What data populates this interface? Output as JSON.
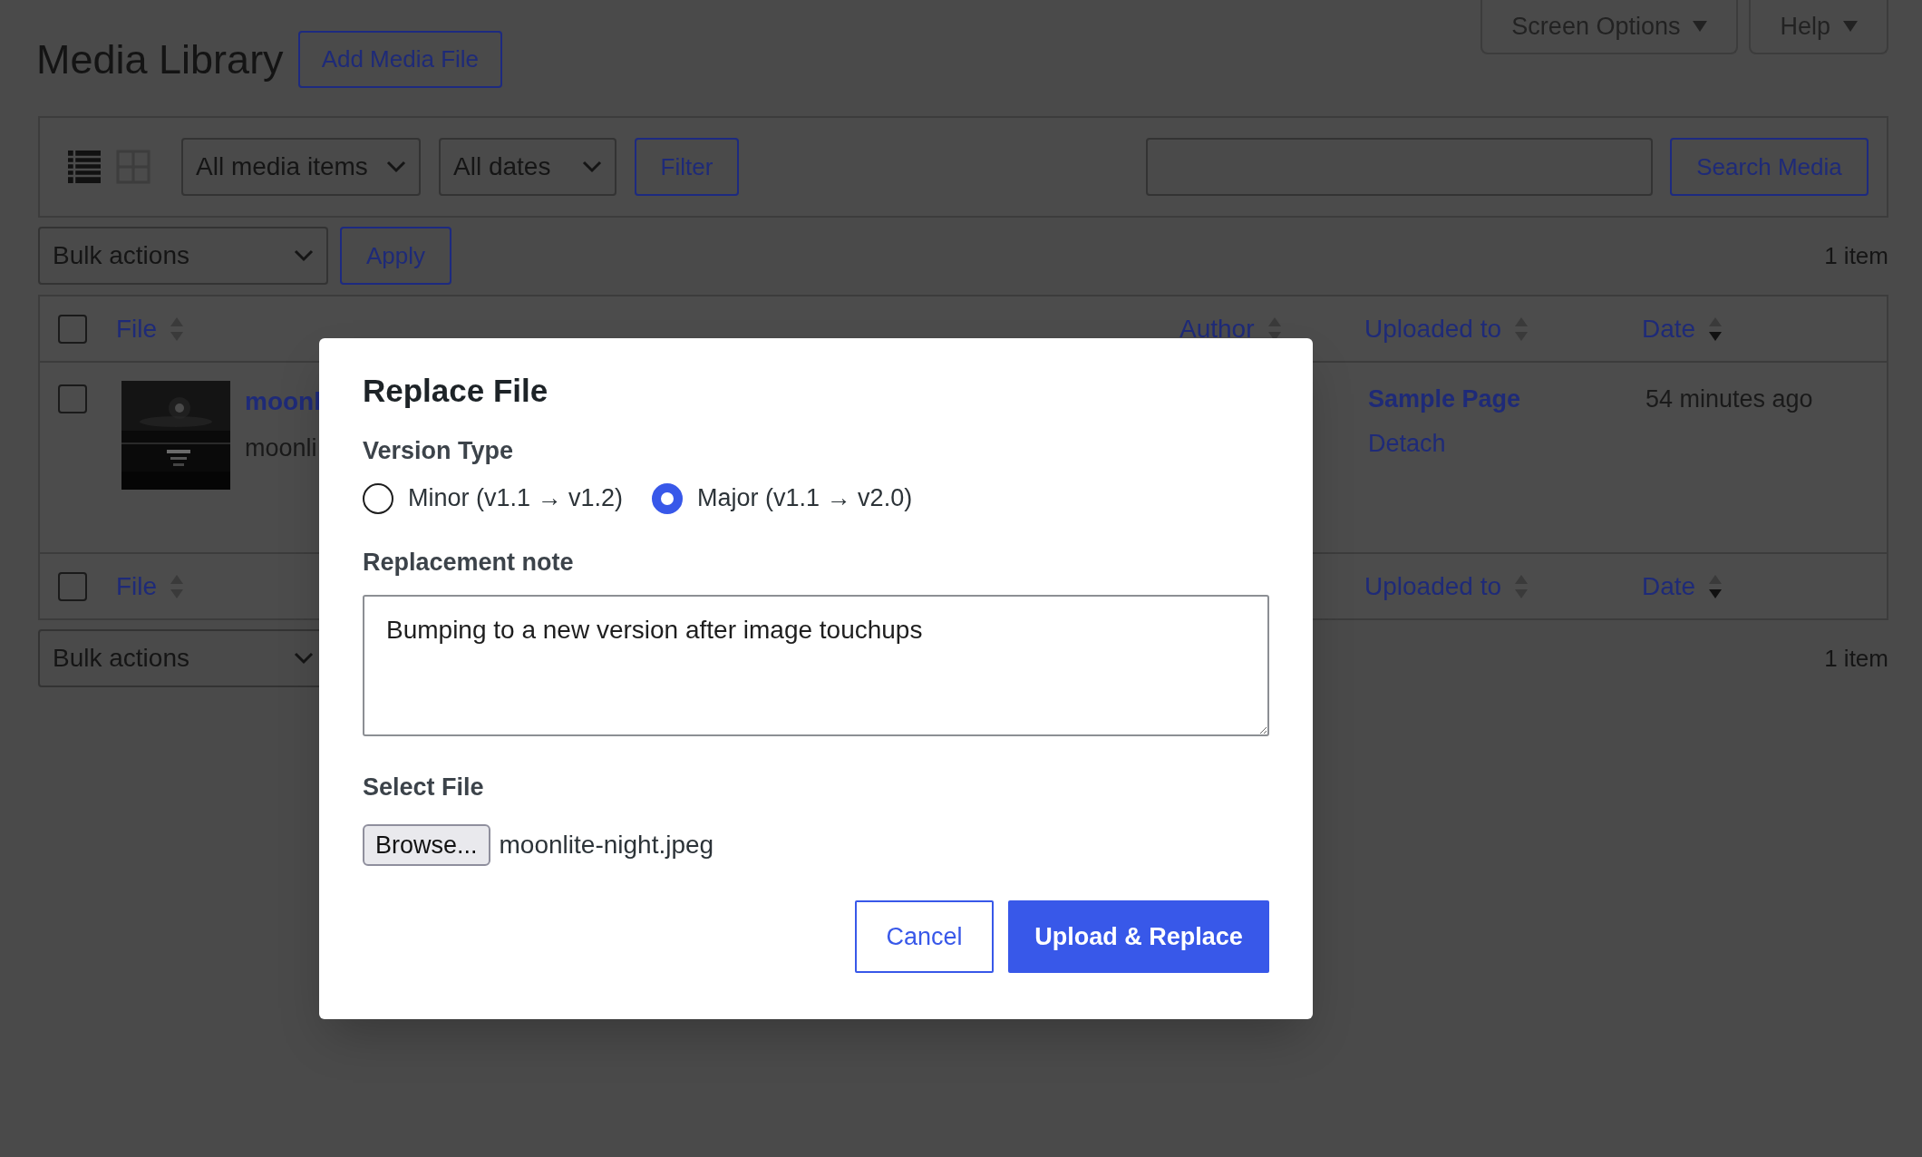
{
  "page": {
    "title": "Media Library",
    "add_button": "Add Media File"
  },
  "screen_tabs": [
    "Screen Options",
    "Help"
  ],
  "filter_bar": {
    "view_modes": [
      {
        "kind": "list",
        "selected": true
      },
      {
        "kind": "grid",
        "selected": false
      }
    ],
    "type_filter": "All media items",
    "date_filter": "All dates",
    "filter_button": "Filter",
    "search_button": "Search Media"
  },
  "top_actions": {
    "bulk": "Bulk actions",
    "apply": "Apply",
    "count": "1 item"
  },
  "table": {
    "header_checked": false,
    "columns": [
      {
        "label": "File",
        "sorted": false
      },
      {
        "label": "Author",
        "sorted": false
      },
      {
        "label": "Uploaded to",
        "sorted": false
      },
      {
        "label": "Date",
        "sorted": true
      }
    ],
    "rows": [
      {
        "checked": false,
        "title": "moonl",
        "filename": "moonli",
        "uploaded_to": "Sample Page",
        "detach": "Detach",
        "date": "54 minutes ago"
      }
    ],
    "footer_checked": false,
    "footer_columns": [
      {
        "label": "File",
        "sorted": false
      },
      {
        "label": "Uploaded to",
        "sorted": false
      },
      {
        "label": "Date",
        "sorted": true
      }
    ]
  },
  "bottom_actions": {
    "bulk": "Bulk actions",
    "count": "1 item"
  },
  "dialog": {
    "title": "Replace File",
    "version_label": "Version Type",
    "options": [
      {
        "label": "Minor (v1.1 → v1.2)",
        "selected": false
      },
      {
        "label": "Major (v1.1 → v2.0)",
        "selected": true
      }
    ],
    "note_label": "Replacement note",
    "note_value": "Bumping to a new version after image touchups",
    "file_label": "Select File",
    "browse_button": "Browse...",
    "file_name": "moonlite-night.jpeg",
    "cancel_button": "Cancel",
    "submit_button": "Upload & Replace"
  }
}
